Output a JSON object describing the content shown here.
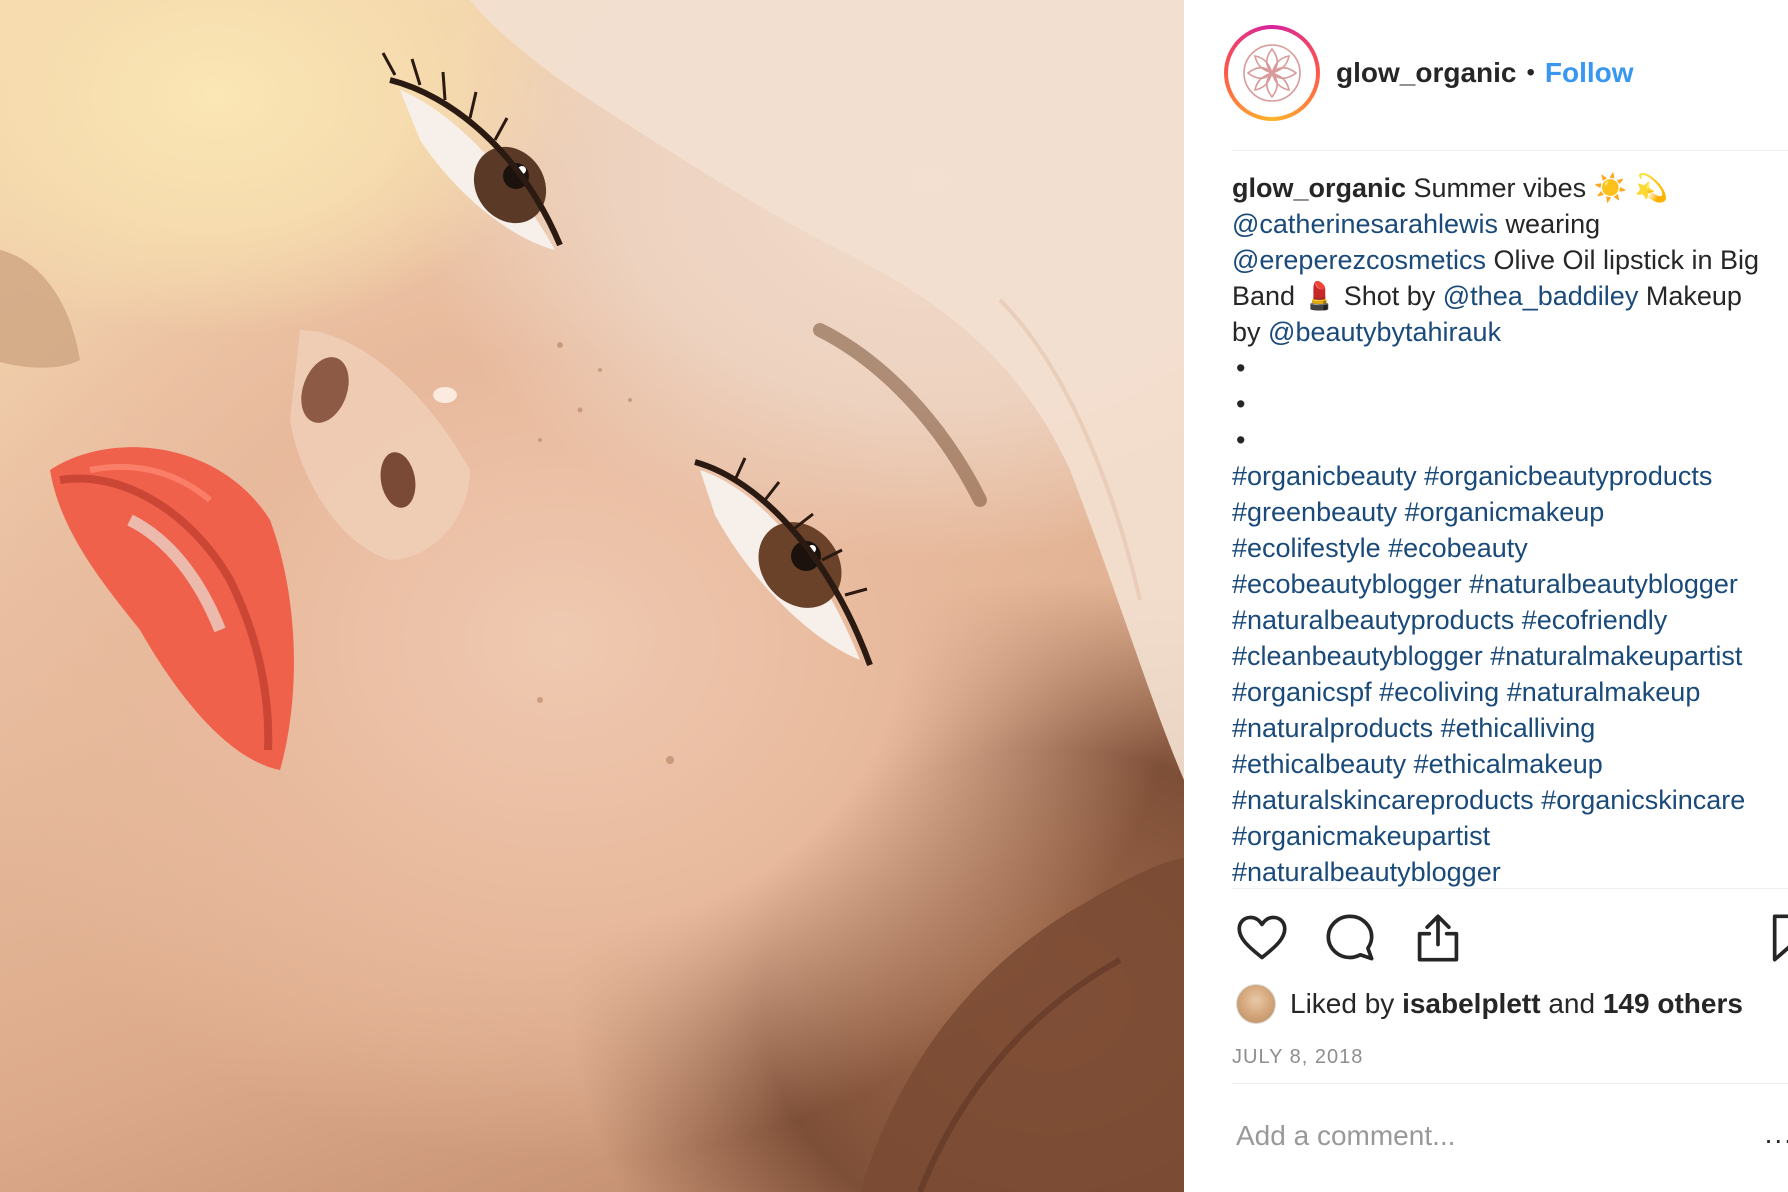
{
  "post": {
    "account": {
      "username": "glow_organic",
      "separator": "•",
      "follow_label": "Follow"
    },
    "caption": {
      "username": "glow_organic",
      "lines": [
        [
          {
            "t": "glow_organic",
            "k": "user"
          },
          {
            "t": " Summer vibes ",
            "k": "text"
          },
          {
            "t": "☀️",
            "k": "emoji"
          },
          {
            "t": " 💫",
            "k": "emoji"
          }
        ],
        [
          {
            "t": "@catherinesarahlewis",
            "k": "link"
          },
          {
            "t": " wearing",
            "k": "text"
          }
        ],
        [
          {
            "t": "@ereperezcosmetics",
            "k": "link"
          },
          {
            "t": " Olive Oil lipstick in Big",
            "k": "text"
          }
        ],
        [
          {
            "t": "Band ",
            "k": "text"
          },
          {
            "t": "💄",
            "k": "emoji"
          },
          {
            "t": " Shot by ",
            "k": "text"
          },
          {
            "t": "@thea_baddiley",
            "k": "link"
          },
          {
            "t": " Makeup",
            "k": "text"
          }
        ],
        [
          {
            "t": "by ",
            "k": "text"
          },
          {
            "t": "@beautybytahirauk",
            "k": "link"
          }
        ],
        [
          {
            "t": "•",
            "k": "bullet"
          }
        ],
        [
          {
            "t": "•",
            "k": "bullet"
          }
        ],
        [
          {
            "t": "•",
            "k": "bullet"
          }
        ],
        [
          {
            "t": "#organicbeauty",
            "k": "link"
          },
          {
            "t": " ",
            "k": "text"
          },
          {
            "t": "#organicbeautyproducts",
            "k": "link"
          }
        ],
        [
          {
            "t": "#greenbeauty",
            "k": "link"
          },
          {
            "t": " ",
            "k": "text"
          },
          {
            "t": "#organicmakeup",
            "k": "link"
          }
        ],
        [
          {
            "t": "#ecolifestyle",
            "k": "link"
          },
          {
            "t": " ",
            "k": "text"
          },
          {
            "t": "#ecobeauty",
            "k": "link"
          }
        ],
        [
          {
            "t": "#ecobeautyblogger",
            "k": "link"
          },
          {
            "t": " ",
            "k": "text"
          },
          {
            "t": "#naturalbeautyblogger",
            "k": "link"
          }
        ],
        [
          {
            "t": "#naturalbeautyproducts",
            "k": "link"
          },
          {
            "t": " ",
            "k": "text"
          },
          {
            "t": "#ecofriendly",
            "k": "link"
          }
        ],
        [
          {
            "t": "#cleanbeautyblogger",
            "k": "link"
          },
          {
            "t": " ",
            "k": "text"
          },
          {
            "t": "#naturalmakeupartist",
            "k": "link"
          }
        ],
        [
          {
            "t": "#organicspf",
            "k": "link"
          },
          {
            "t": " ",
            "k": "text"
          },
          {
            "t": "#ecoliving",
            "k": "link"
          },
          {
            "t": " ",
            "k": "text"
          },
          {
            "t": "#naturalmakeup",
            "k": "link"
          }
        ],
        [
          {
            "t": "#naturalproducts",
            "k": "link"
          },
          {
            "t": " ",
            "k": "text"
          },
          {
            "t": "#ethicalliving",
            "k": "link"
          }
        ],
        [
          {
            "t": "#ethicalbeauty",
            "k": "link"
          },
          {
            "t": " ",
            "k": "text"
          },
          {
            "t": "#ethicalmakeup",
            "k": "link"
          }
        ],
        [
          {
            "t": "#naturalskincareproducts",
            "k": "link"
          },
          {
            "t": " ",
            "k": "text"
          },
          {
            "t": "#organicskincare",
            "k": "link"
          }
        ],
        [
          {
            "t": "#organicmakeupartist",
            "k": "link"
          }
        ],
        [
          {
            "t": "#naturalbeautyblogger",
            "k": "link"
          }
        ]
      ]
    },
    "actions": {
      "like_icon": "heart-icon",
      "comment_icon": "comment-icon",
      "share_icon": "share-icon",
      "save_icon": "bookmark-icon"
    },
    "likes": {
      "prefix": "Liked by",
      "liker": "isabelplett",
      "conjunction": "and",
      "others": "149 others"
    },
    "date": "JULY 8, 2018",
    "comment_box": {
      "placeholder": "Add a comment...",
      "more_label": "..."
    }
  },
  "colors": {
    "link": "#1a4a7a",
    "follow": "#3897f0",
    "text": "#262626",
    "muted": "#8e8e8e",
    "lipstick": "#f0614c"
  }
}
